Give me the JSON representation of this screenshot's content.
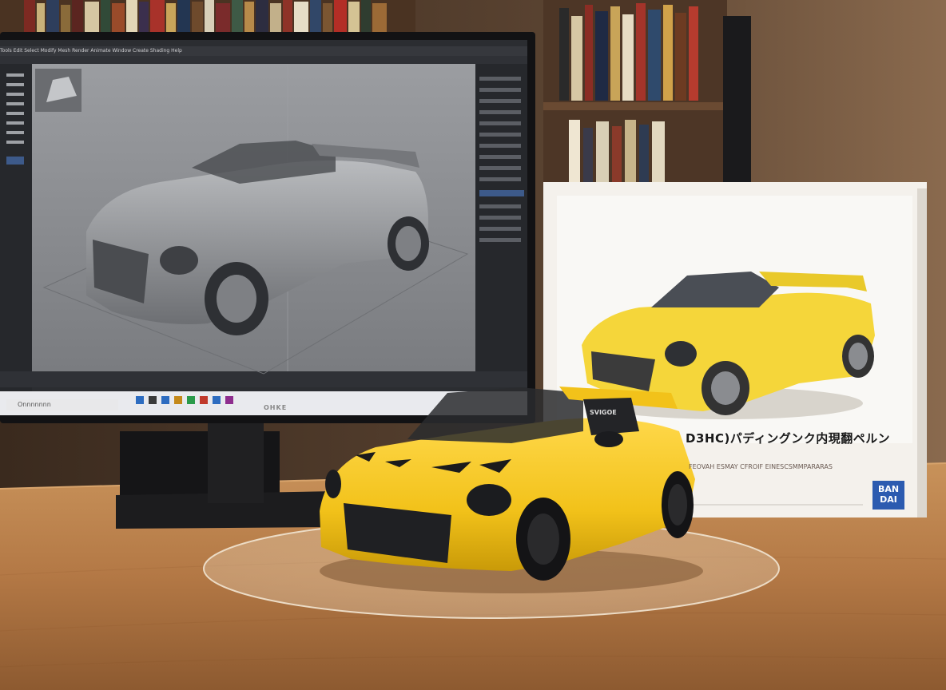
{
  "monitor": {
    "brand_label": "OHKE",
    "taskbar_search_text": "Onnnnnnn",
    "software_menu": "Tools  Edit  Select  Modify  Mesh  Render  Animate  Window  Create  Shading  Help",
    "viewport_name": "3d-viewport"
  },
  "model_box": {
    "title": "D3HC)パディングンク内現翻ペルン",
    "subtitle": "FEOVAH ESMAY CFROIF EINESCSMMPARARAS",
    "brand": "BAN DAI"
  },
  "car": {
    "plate_text": "SVIGOE",
    "color": "#f2c21a"
  },
  "colors": {
    "viewport_bg": "#8e9094",
    "ui_dark": "#2b2d31",
    "desk": "#b57b47",
    "box_bg": "#f4f1ec",
    "brand_blue": "#2c5bb0"
  }
}
